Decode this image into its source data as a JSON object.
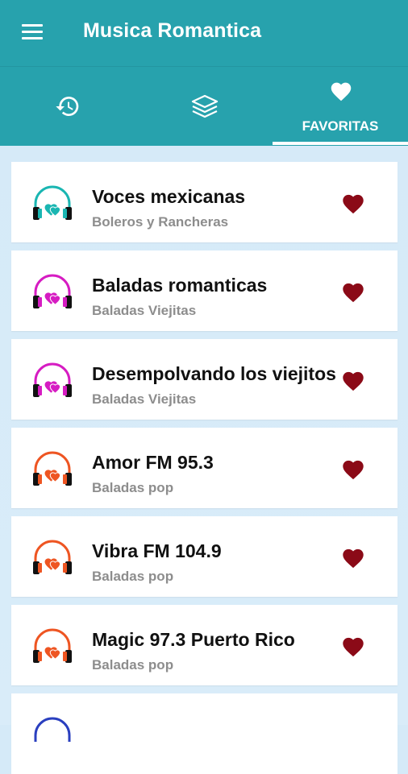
{
  "app": {
    "title": "Musica Romantica"
  },
  "tabs": [
    {
      "icon": "history-icon",
      "label": ""
    },
    {
      "icon": "layers-icon",
      "label": ""
    },
    {
      "icon": "heart-icon",
      "label": "FAVORITAS",
      "selected": true
    }
  ],
  "colors": {
    "primary": "#27a2ad",
    "background": "#d5eaf8",
    "favorite": "#8b0a17",
    "teal_headphones": "#1ab6b2",
    "pink_headphones": "#d61cc2",
    "orange_headphones": "#ee5522"
  },
  "stations": [
    {
      "name": "Voces mexicanas",
      "genre": "Boleros y Rancheras",
      "thumb_color": "#1ab6b2",
      "favorite": true
    },
    {
      "name": "Baladas romanticas",
      "genre": "Baladas Viejitas",
      "thumb_color": "#d61cc2",
      "favorite": true
    },
    {
      "name": "Desempolvando los viejitos",
      "genre": "Baladas Viejitas",
      "thumb_color": "#d61cc2",
      "favorite": true
    },
    {
      "name": "Amor FM 95.3",
      "genre": "Baladas pop",
      "thumb_color": "#ee5522",
      "favorite": true
    },
    {
      "name": "Vibra FM 104.9",
      "genre": "Baladas pop",
      "thumb_color": "#ee5522",
      "favorite": true
    },
    {
      "name": "Magic 97.3  Puerto Rico",
      "genre": "Baladas pop",
      "thumb_color": "#ee5522",
      "favorite": true
    }
  ]
}
